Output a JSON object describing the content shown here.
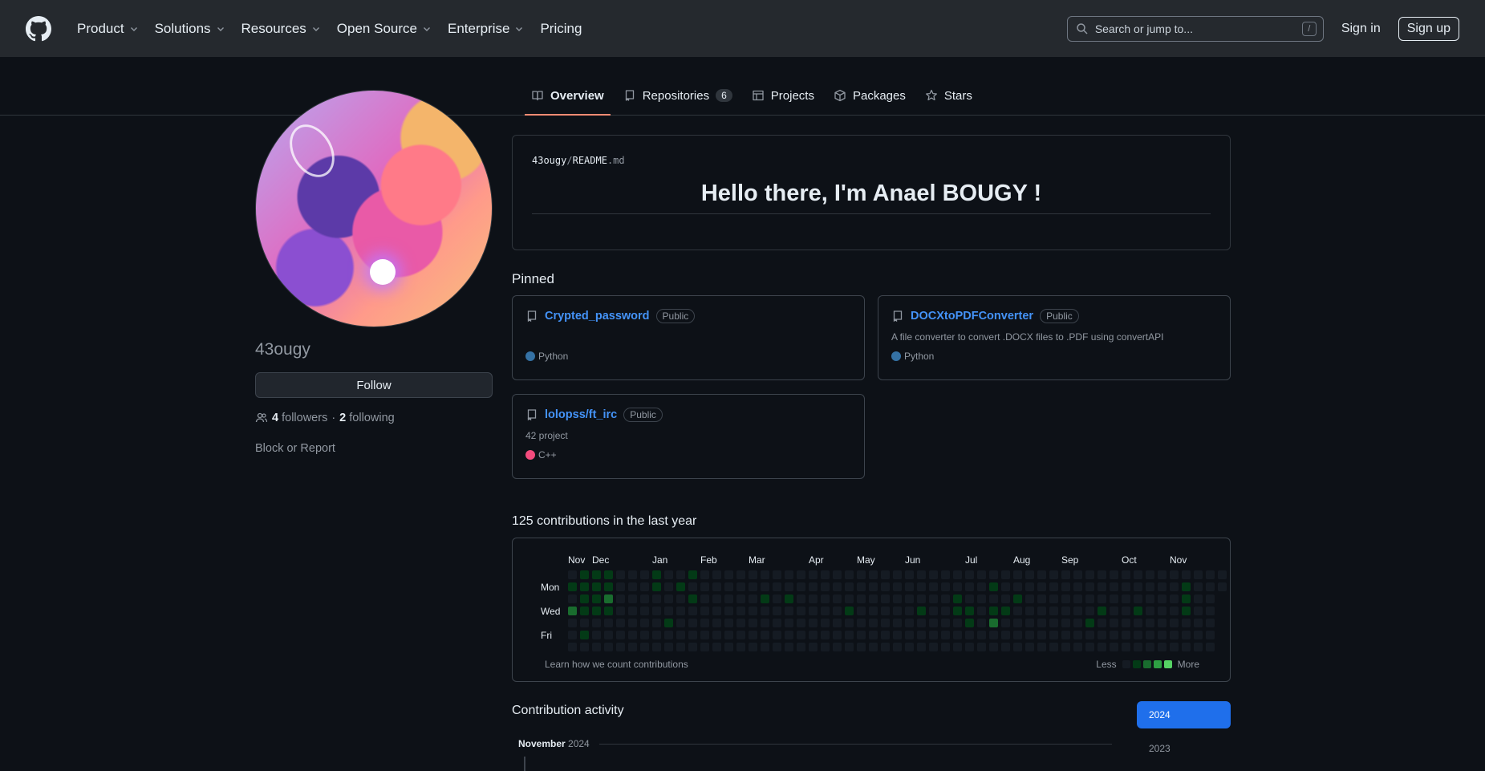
{
  "header": {
    "nav": [
      {
        "label": "Product",
        "has_menu": true
      },
      {
        "label": "Solutions",
        "has_menu": true
      },
      {
        "label": "Resources",
        "has_menu": true
      },
      {
        "label": "Open Source",
        "has_menu": true
      },
      {
        "label": "Enterprise",
        "has_menu": true
      },
      {
        "label": "Pricing",
        "has_menu": false
      }
    ],
    "search_placeholder": "Search or jump to...",
    "search_shortcut": "/",
    "sign_in": "Sign in",
    "sign_up": "Sign up"
  },
  "tabs": [
    {
      "label": "Overview",
      "icon": "book-icon",
      "active": true
    },
    {
      "label": "Repositories",
      "icon": "repo-icon",
      "count": "6"
    },
    {
      "label": "Projects",
      "icon": "table-icon"
    },
    {
      "label": "Packages",
      "icon": "package-icon"
    },
    {
      "label": "Stars",
      "icon": "star-icon"
    }
  ],
  "profile": {
    "username": "43ougy",
    "follow_label": "Follow",
    "followers_count": "4",
    "followers_label": "followers",
    "separator": "·",
    "following_count": "2",
    "following_label": "following",
    "block_report": "Block or Report"
  },
  "readme": {
    "owner": "43ougy",
    "separator": "/",
    "file": "README",
    "ext": ".md",
    "heading": "Hello there, I'm Anael BOUGY !"
  },
  "pinned": {
    "title": "Pinned",
    "repos": [
      {
        "name": "Crypted_password",
        "visibility": "Public",
        "description": "",
        "language": "Python",
        "lang_color": "#3572A5"
      },
      {
        "name": "DOCXtoPDFConverter",
        "visibility": "Public",
        "description": "A file converter to convert .DOCX files to .PDF using convertAPI",
        "language": "Python",
        "lang_color": "#3572A5"
      },
      {
        "name": "lolopss/ft_irc",
        "visibility": "Public",
        "description": "42 project",
        "language": "C++",
        "lang_color": "#f34b7d"
      }
    ]
  },
  "contributions": {
    "title": "125 contributions in the last year",
    "months": [
      "Nov",
      "Dec",
      "Jan",
      "Feb",
      "Mar",
      "Apr",
      "May",
      "Jun",
      "Jul",
      "Aug",
      "Sep",
      "Oct",
      "Nov"
    ],
    "days": [
      "Mon",
      "Wed",
      "Fri"
    ],
    "learn_link": "Learn how we count contributions",
    "less": "Less",
    "more": "More",
    "colors": [
      "#151b23",
      "#033a16",
      "#196c2e",
      "#2ea043",
      "#56d364"
    ],
    "grid_levels": [
      "0111000100100000000000000000000000000000000000000000000",
      "1111000101000000000000000000000000010000000000000001000",
      "0112000000100000101000000000000010000100000000000001000",
      "2111000000000000000000010000010011011000000010010001000",
      "0000000010000000000000000000000001020000000100000000000",
      "0100000000000000000000000000000000000000000000000000000",
      "0000000000000000000000000000000000000000000000000000000"
    ]
  },
  "activity": {
    "title": "Contribution activity",
    "years": [
      "2024",
      "2023"
    ],
    "month": "November",
    "month_year": "2024"
  }
}
